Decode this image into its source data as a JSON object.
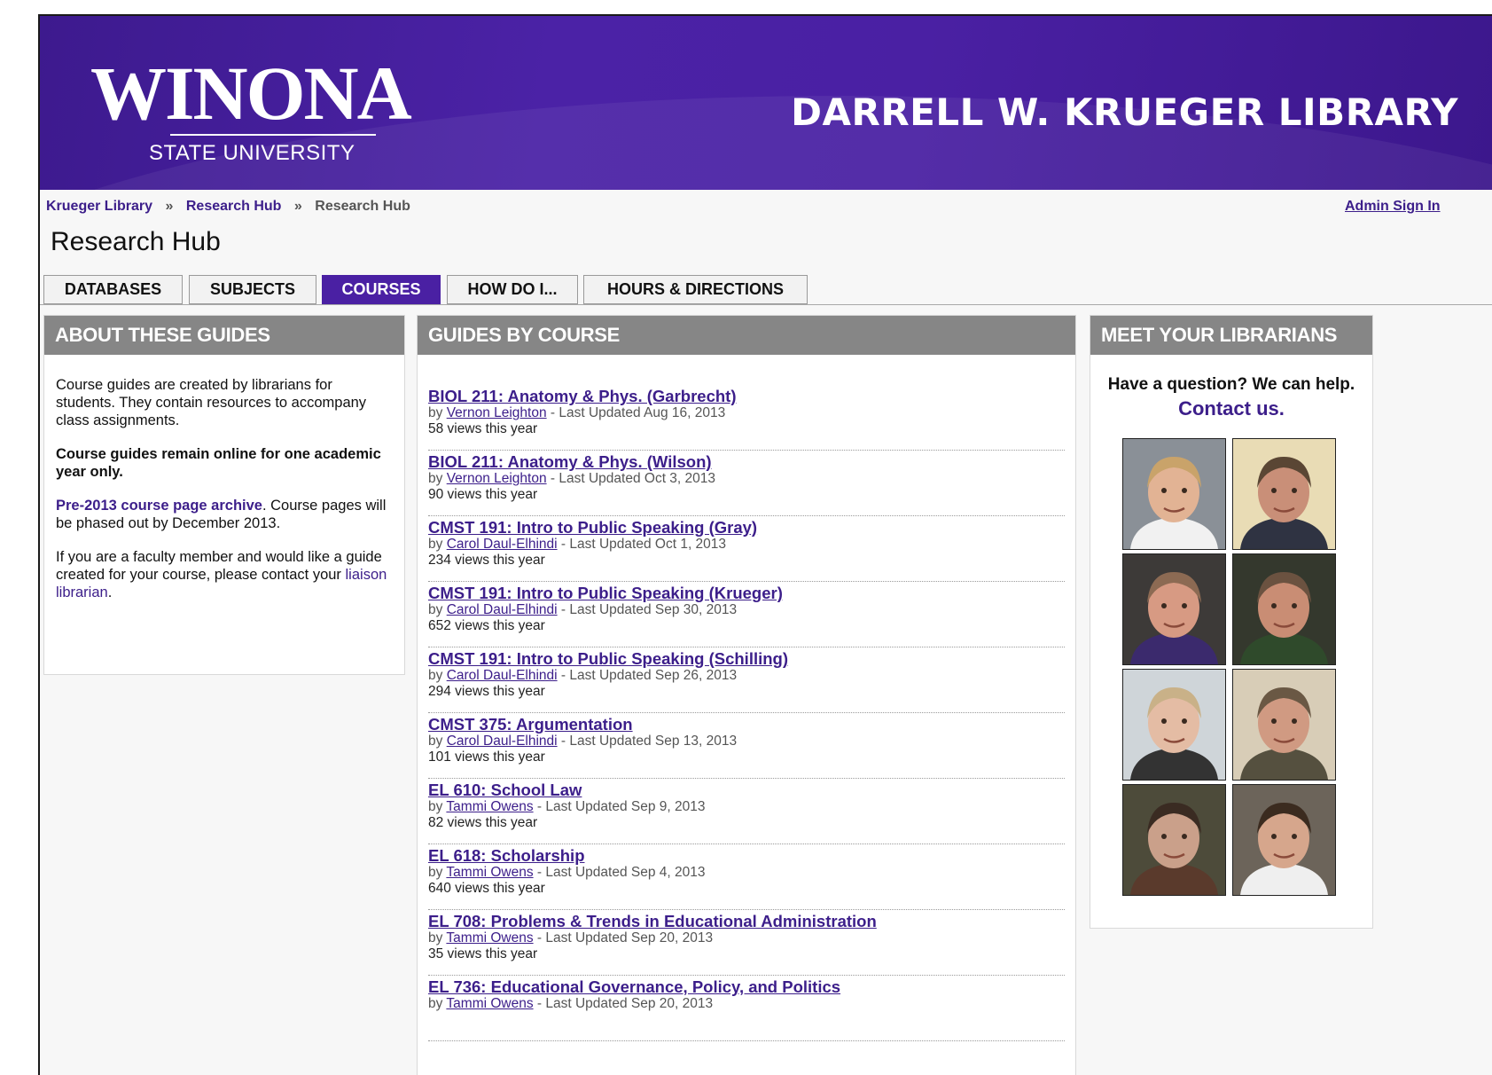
{
  "header": {
    "logo_word": "WINONA",
    "logo_sub": "STATE UNIVERSITY",
    "library_title": "DARRELL W. KRUEGER LIBRARY"
  },
  "breadcrumb": {
    "items": [
      "Krueger Library",
      "Research Hub",
      "Research Hub"
    ],
    "separator": "»"
  },
  "admin_link": "Admin Sign In",
  "page_title": "Research Hub",
  "tabs": [
    {
      "label": "DATABASES",
      "active": false
    },
    {
      "label": "SUBJECTS",
      "active": false
    },
    {
      "label": "COURSES",
      "active": true
    },
    {
      "label": "HOW DO I...",
      "active": false
    },
    {
      "label": "HOURS & DIRECTIONS",
      "active": false
    }
  ],
  "about": {
    "heading": "ABOUT THESE GUIDES",
    "p1": "Course guides are created by librarians for students. They contain resources to accompany class assignments.",
    "p2": "Course guides remain online for one academic year only.",
    "p3_link": "Pre-2013 course page archive",
    "p3_text": ". Course pages will be phased out by December 2013.",
    "p4_text": "If you are a faculty member and would like a guide created for your course, please contact your ",
    "p4_link": "liaison librarian",
    "p4_end": "."
  },
  "guides": {
    "heading": "GUIDES BY COURSE",
    "by_prefix": "by ",
    "updated_prefix": " - Last Updated ",
    "views_suffix": " views this year",
    "items": [
      {
        "title": "BIOL 211: Anatomy & Phys. (Garbrecht)",
        "author": "Vernon Leighton",
        "updated": "Aug 16, 2013",
        "views": "58"
      },
      {
        "title": "BIOL 211: Anatomy & Phys. (Wilson)",
        "author": "Vernon Leighton",
        "updated": "Oct 3, 2013",
        "views": "90"
      },
      {
        "title": "CMST 191: Intro to Public Speaking (Gray)",
        "author": "Carol Daul-Elhindi",
        "updated": "Oct 1, 2013",
        "views": "234"
      },
      {
        "title": "CMST 191: Intro to Public Speaking (Krueger)",
        "author": "Carol Daul-Elhindi",
        "updated": "Sep 30, 2013",
        "views": "652"
      },
      {
        "title": "CMST 191: Intro to Public Speaking (Schilling)",
        "author": "Carol Daul-Elhindi",
        "updated": "Sep 26, 2013",
        "views": "294"
      },
      {
        "title": "CMST 375: Argumentation",
        "author": "Carol Daul-Elhindi",
        "updated": "Sep 13, 2013",
        "views": "101"
      },
      {
        "title": "EL 610: School Law",
        "author": "Tammi Owens",
        "updated": "Sep 9, 2013",
        "views": "82"
      },
      {
        "title": "EL 618: Scholarship",
        "author": "Tammi Owens",
        "updated": "Sep 4, 2013",
        "views": "640"
      },
      {
        "title": "EL 708: Problems & Trends in Educational Administration",
        "author": "Tammi Owens",
        "updated": "Sep 20, 2013",
        "views": "35"
      },
      {
        "title": "EL 736: Educational Governance, Policy, and Politics",
        "author": "Tammi Owens",
        "updated": "Sep 20, 2013",
        "views": ""
      }
    ]
  },
  "librarians": {
    "heading": "MEET YOUR LIBRARIANS",
    "question": "Have a question? We can help.",
    "contact_link": "Contact us.",
    "photos": [
      {
        "bg": "#8a9097",
        "skin": "#e2b394",
        "hair": "#c9a36a",
        "shirt": "#f1f1f1"
      },
      {
        "bg": "#e9dcb5",
        "skin": "#c98f78",
        "hair": "#5a4634",
        "shirt": "#2f3342"
      },
      {
        "bg": "#3d3a38",
        "skin": "#d79a83",
        "hair": "#8c6a53",
        "shirt": "#3b2a6d"
      },
      {
        "bg": "#34382d",
        "skin": "#c98d74",
        "hair": "#6b5240",
        "shirt": "#2f4a2b"
      },
      {
        "bg": "#cfd5d9",
        "skin": "#e4bca4",
        "hair": "#c9b188",
        "shirt": "#333333"
      },
      {
        "bg": "#d8cdb7",
        "skin": "#d09a82",
        "hair": "#6a5844",
        "shirt": "#55503f"
      },
      {
        "bg": "#4d4b3a",
        "skin": "#caa08a",
        "hair": "#3a2b22",
        "shirt": "#5a3a2c"
      },
      {
        "bg": "#6c645a",
        "skin": "#d6a68c",
        "hair": "#3b2b1f",
        "shirt": "#efefef"
      }
    ]
  },
  "colors": {
    "brand_purple": "#4a20a3",
    "link_purple": "#3c1e8a",
    "panel_header_gray": "#868686"
  }
}
